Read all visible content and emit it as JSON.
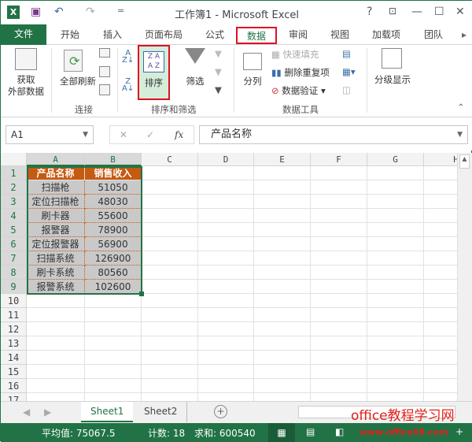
{
  "window": {
    "title": "工作簿1 - Microsoft Excel",
    "help": "?",
    "min": "—",
    "max": "☐",
    "close": "✕"
  },
  "quick": {
    "logo": "X",
    "undo": "↶",
    "redo": "↷",
    "more": "="
  },
  "tabs": [
    "文件",
    "开始",
    "插入",
    "页面布局",
    "公式",
    "数据",
    "审阅",
    "视图",
    "加载项",
    "团队"
  ],
  "ribbon": {
    "get_external": "获取\n外部数据",
    "get_external1": "获取",
    "get_external2": "外部数据",
    "refresh_all": "全部刷新",
    "group_connect": "连接",
    "sort": "排序",
    "filter": "筛选",
    "group_sort": "排序和筛选",
    "text_to_columns": "分列",
    "flash_fill": "快速填充",
    "remove_dup": "删除重复项",
    "validation": "数据验证",
    "group_tools": "数据工具",
    "outline": "分级显示"
  },
  "formula": {
    "name_box": "A1",
    "cancel": "✕",
    "enter": "✓",
    "fx": "fx",
    "value": "产品名称"
  },
  "columns": [
    "A",
    "B",
    "C",
    "D",
    "E",
    "F",
    "G",
    "H"
  ],
  "rows": [
    "1",
    "2",
    "3",
    "4",
    "5",
    "6",
    "7",
    "8",
    "9",
    "10",
    "11",
    "12",
    "13",
    "14",
    "15",
    "16",
    "17"
  ],
  "table": {
    "headers": [
      "产品名称",
      "销售收入"
    ],
    "data": [
      [
        "扫描枪",
        "51050"
      ],
      [
        "定位扫描枪",
        "48030"
      ],
      [
        "刷卡器",
        "55600"
      ],
      [
        "报警器",
        "78900"
      ],
      [
        "定位报警器",
        "56900"
      ],
      [
        "扫描系统",
        "126900"
      ],
      [
        "刷卡系统",
        "80560"
      ],
      [
        "报警系统",
        "102600"
      ]
    ]
  },
  "sheets": [
    "Sheet1",
    "Sheet2"
  ],
  "watermark": {
    "site": "office教程学习网",
    "url": "www.office68.com"
  },
  "status": {
    "avg": "平均值: 75067.5",
    "count": "计数: 18",
    "sum": "求和: 600540"
  }
}
